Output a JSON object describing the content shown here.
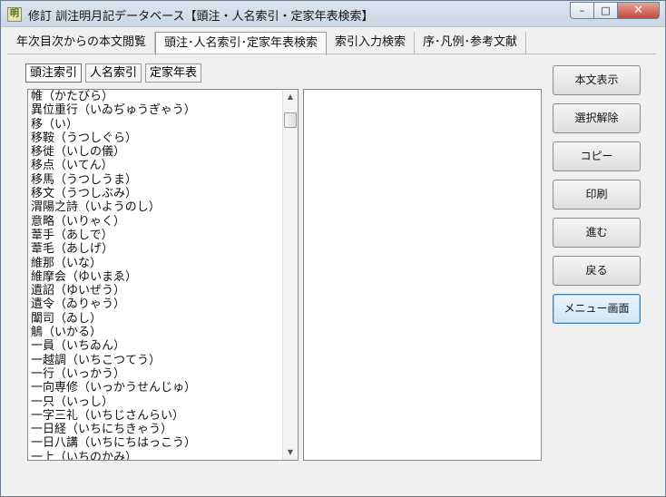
{
  "window": {
    "title": "修訂 訓注明月記データベース【頭注・人名索引・定家年表検索】",
    "app_icon_text": "明"
  },
  "tabs": [
    {
      "label": "年次目次からの本文閲覧"
    },
    {
      "label": "頭注･人名索引･定家年表検索"
    },
    {
      "label": "索引入力検索"
    },
    {
      "label": "序･凡例･参考文献"
    }
  ],
  "subtabs": [
    {
      "label": "頭注索引"
    },
    {
      "label": "人名索引"
    },
    {
      "label": "定家年表"
    }
  ],
  "list": [
    "帷（かたびら）",
    "異位重行（いゐぢゅうぎゃう）",
    "移（い）",
    "移鞍（うつしぐら）",
    "移徙（いしの儀）",
    "移点（いてん）",
    "移馬（うつしうま）",
    "移文（うつしぶみ）",
    "渭陽之詩（いようのし）",
    "意略（いりゃく）",
    "葦手（あしで）",
    "葦毛（あしげ）",
    "維那（いな）",
    "維摩会（ゆいまゑ）",
    "遺詔（ゆいぜう）",
    "遺令（ゐりゃう）",
    "闈司（ゐし）",
    "鵤（いかる）",
    "一員（いちゐん）",
    "一越調（いちこつてう）",
    "一行（いっかう）",
    "一向専修（いっかうせんじゅ）",
    "一只（いっし）",
    "一字三礼（いちじさんらい）",
    "一日経（いちにちきゃう）",
    "一日八講（いちにちはっこう）",
    "一上（いちのかみ）"
  ],
  "buttons": {
    "show_text": "本文表示",
    "clear_selection": "選択解除",
    "copy": "コピー",
    "print": "印刷",
    "forward": "進む",
    "back": "戻る",
    "menu": "メニュー画面"
  },
  "scrollbar": {
    "up_glyph": "▲",
    "down_glyph": "▼"
  },
  "caption": {
    "minimize": "–",
    "maximize": "□",
    "close": "✕"
  }
}
